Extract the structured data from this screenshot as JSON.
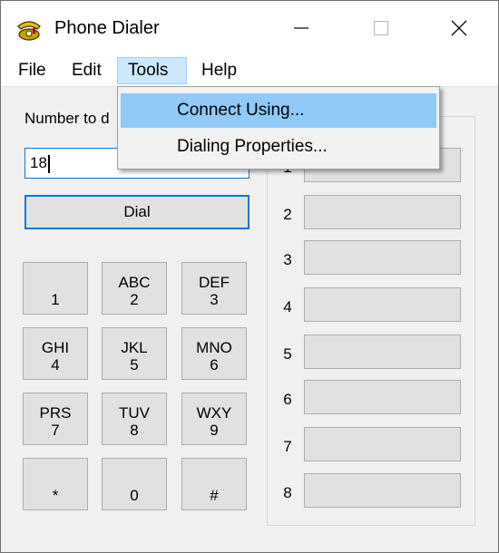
{
  "window": {
    "title": "Phone Dialer",
    "icon": "phone-icon"
  },
  "menubar": {
    "items": [
      "File",
      "Edit",
      "Tools",
      "Help"
    ],
    "open_menu": "Tools"
  },
  "tools_menu": {
    "items": [
      "Connect Using...",
      "Dialing Properties..."
    ],
    "highlighted": "Connect Using..."
  },
  "number_label": "Number to d",
  "number_value": "18",
  "dial_label": "Dial",
  "keypad": [
    {
      "letters": "",
      "digit": "1"
    },
    {
      "letters": "ABC",
      "digit": "2"
    },
    {
      "letters": "DEF",
      "digit": "3"
    },
    {
      "letters": "GHI",
      "digit": "4"
    },
    {
      "letters": "JKL",
      "digit": "5"
    },
    {
      "letters": "MNO",
      "digit": "6"
    },
    {
      "letters": "PRS",
      "digit": "7"
    },
    {
      "letters": "TUV",
      "digit": "8"
    },
    {
      "letters": "WXY",
      "digit": "9"
    },
    {
      "letters": "",
      "digit": "*"
    },
    {
      "letters": "",
      "digit": "0"
    },
    {
      "letters": "",
      "digit": "#"
    }
  ],
  "speed_dial": [
    "1",
    "2",
    "3",
    "4",
    "5",
    "6",
    "7",
    "8"
  ],
  "colors": {
    "focus": "#0078d7",
    "menu_highlight": "#91c9f7",
    "menu_selected": "#cce8ff"
  }
}
